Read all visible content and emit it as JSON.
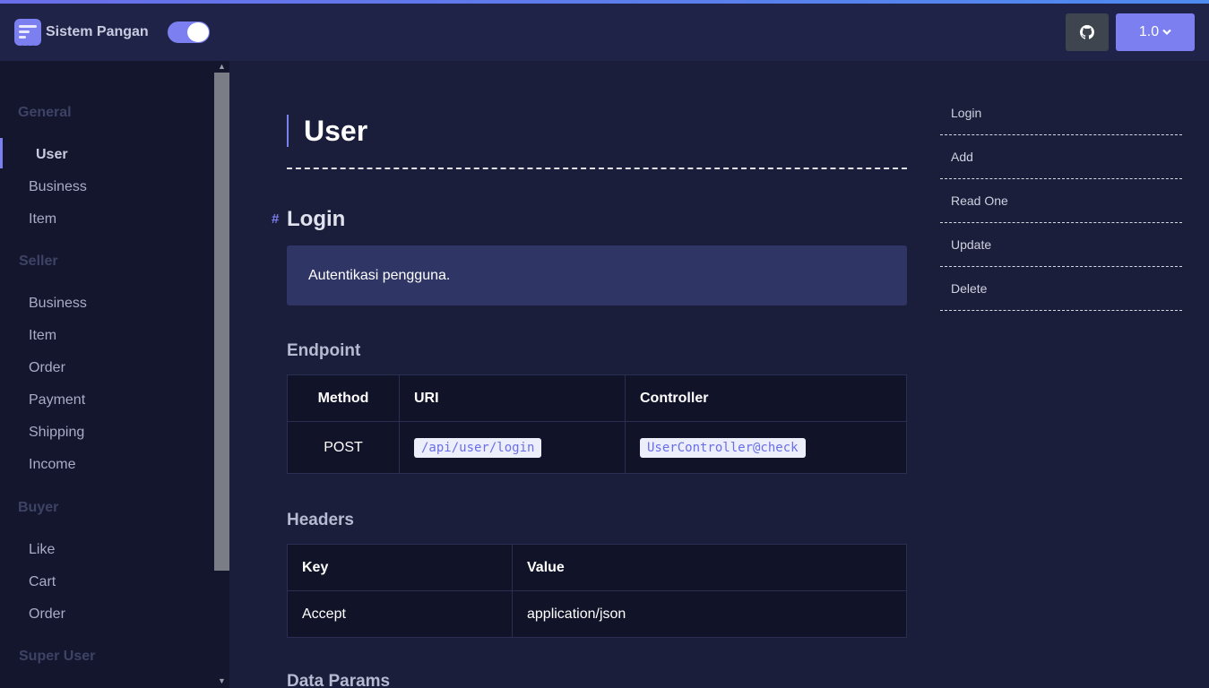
{
  "app": {
    "name": "Sistem Pangan",
    "version_label": "1.0"
  },
  "topbar": {
    "theme_toggle_on": true,
    "github_icon": "github-icon",
    "version_icon": "chevron-down-icon"
  },
  "colors": {
    "accent": "#7b7fef",
    "topbar_bg": "#1f2347",
    "sidebar_bg": "#14162d",
    "main_bg": "#1b1e3b"
  },
  "sidebar": {
    "sections": [
      {
        "title": "General",
        "items": [
          "User",
          "Business",
          "Item"
        ]
      },
      {
        "title": "Seller",
        "items": [
          "Business",
          "Item",
          "Order",
          "Payment",
          "Shipping",
          "Income"
        ]
      },
      {
        "title": "Buyer",
        "items": [
          "Like",
          "Cart",
          "Order"
        ]
      },
      {
        "title": "Super User",
        "items": []
      }
    ],
    "active_item": "User"
  },
  "main": {
    "title": "User",
    "section": {
      "anchor": "#",
      "title": "Login",
      "description": "Autentikasi pengguna.",
      "endpoint": {
        "heading": "Endpoint",
        "columns": [
          "Method",
          "URI",
          "Controller"
        ],
        "row": {
          "method": "POST",
          "uri": "/api/user/login",
          "controller": "UserController@check"
        }
      },
      "headers": {
        "heading": "Headers",
        "columns": [
          "Key",
          "Value"
        ],
        "row": {
          "key": "Accept",
          "value": "application/json"
        }
      },
      "next_heading": "Data Params"
    }
  },
  "toc": [
    "Login",
    "Add",
    "Read One",
    "Update",
    "Delete"
  ]
}
